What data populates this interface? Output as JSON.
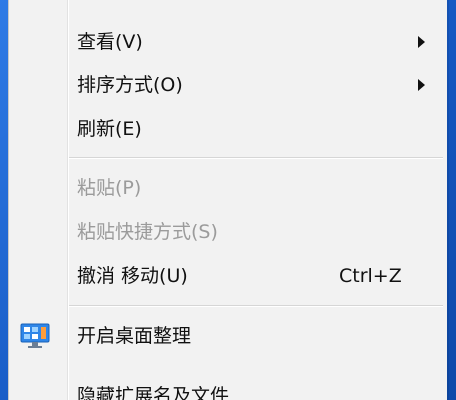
{
  "context_menu": {
    "items": [
      {
        "label": "查看(V)",
        "has_submenu": true,
        "enabled": true
      },
      {
        "label": "排序方式(O)",
        "has_submenu": true,
        "enabled": true
      },
      {
        "label": "刷新(E)",
        "has_submenu": false,
        "enabled": true
      },
      {
        "label": "粘贴(P)",
        "has_submenu": false,
        "enabled": false
      },
      {
        "label": "粘贴快捷方式(S)",
        "has_submenu": false,
        "enabled": false
      },
      {
        "label": "撤消 移动(U)",
        "shortcut": "Ctrl+Z",
        "has_submenu": false,
        "enabled": true
      },
      {
        "label": "开启桌面整理",
        "icon": "desktop-tidy-icon",
        "has_submenu": false,
        "enabled": true
      },
      {
        "label": "隐藏扩展名及文件",
        "has_submenu": false,
        "enabled": true
      }
    ]
  },
  "colors": {
    "menu_background": "#f2f2f2",
    "disabled_text": "#9b9b9b",
    "desktop_blue": "#1f63c9"
  }
}
